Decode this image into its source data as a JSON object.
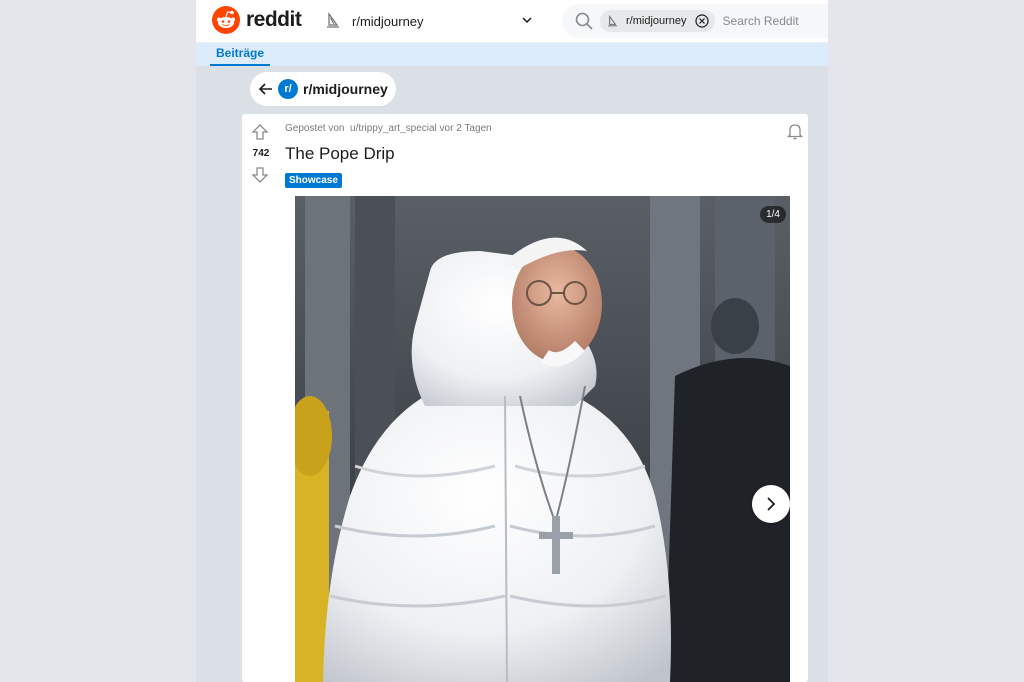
{
  "header": {
    "logo_text": "reddit",
    "community_select": {
      "label": "r/midjourney",
      "icon": "sailboat-icon"
    },
    "search": {
      "chip_label": "r/midjourney",
      "placeholder": "Search Reddit"
    }
  },
  "tabs": [
    {
      "label": "Beiträge",
      "active": true
    }
  ],
  "back_bar": {
    "sub_icon_label": "r/",
    "community": "r/midjourney"
  },
  "post": {
    "votes": "742",
    "posted_prefix": "Gepostet von",
    "author": "u/trippy_art_special",
    "time": "vor 2 Tagen",
    "title": "The Pope Drip",
    "flair": "Showcase",
    "gallery_counter": "1/4"
  },
  "colors": {
    "brand": "#ff4500",
    "accent": "#0079d3",
    "tab_bar": "#dcecfb",
    "page_bg": "#dae0e6"
  }
}
